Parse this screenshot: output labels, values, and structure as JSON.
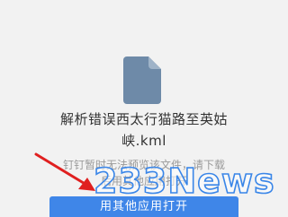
{
  "file": {
    "icon": "document-icon",
    "icon_color": "#6e8aa8",
    "name": "解析错误西太行猫路至英姑\n峡.kml"
  },
  "hint": "钉钉暂时无法预览该文件，请下载\n后用其他应用打开",
  "actions": {
    "open_with_other_app_label": "用其他应用打开"
  },
  "annotation": {
    "arrow_color": "#e02020"
  },
  "watermark": {
    "text": "233News",
    "color": "#3a86e8"
  }
}
